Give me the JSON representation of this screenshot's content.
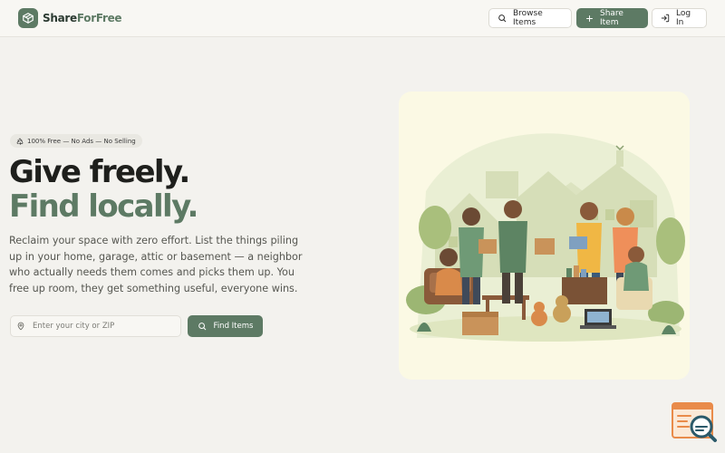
{
  "brand": {
    "name_part1": "Share",
    "name_part2": "ForFree",
    "primary_color": "#5d7a64"
  },
  "header": {
    "browse_label": "Browse Items",
    "share_label": "Share Item",
    "login_label": "Log In"
  },
  "hero": {
    "badge": "100% Free — No Ads — No Selling",
    "headline_line1": "Give freely.",
    "headline_line2": "Find locally.",
    "description": "Reclaim your space with zero effort. List the things piling up in your home, garage, attic or basement — a neighbor who actually needs them comes and picks them up. You free up room, they get something useful, everyone wins.",
    "search_placeholder": "Enter your city or ZIP",
    "search_value": "",
    "find_label": "Find Items"
  },
  "icons": {
    "logo": "box-share-icon",
    "browse": "search-icon",
    "share": "plus-icon",
    "login": "login-icon",
    "badge": "recycle-icon",
    "location": "map-pin-icon",
    "find": "search-icon",
    "widget": "feedback-search-icon"
  }
}
